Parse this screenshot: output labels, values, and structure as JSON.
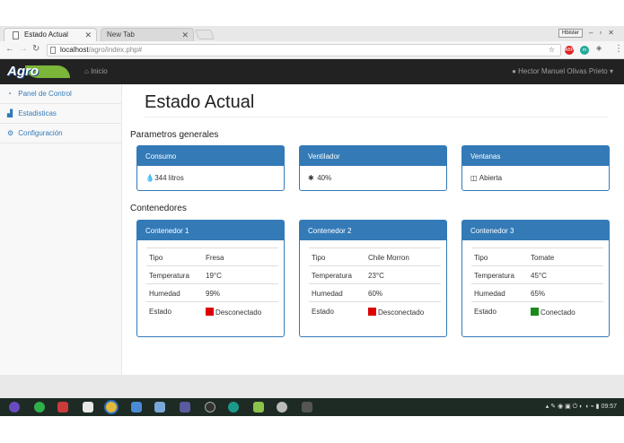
{
  "browser": {
    "tabs": [
      {
        "label": "Estado Actual",
        "active": true
      },
      {
        "label": "New Tab",
        "active": false
      }
    ],
    "profile_chip": "Hbister",
    "url_host": "localhost",
    "url_path": "/agro/index.php#",
    "ext_badges": [
      "ABP",
      "m"
    ]
  },
  "navbar": {
    "brand": "Agro",
    "home_label": "Inicio",
    "user_name": "Hector Manuel Olivas Prieto"
  },
  "sidebar": {
    "items": [
      {
        "label": "Panel de Control",
        "icon": "dashboard-icon"
      },
      {
        "label": "Estadisticas",
        "icon": "area-chart-icon"
      },
      {
        "label": "Configuración",
        "icon": "cogs-icon"
      }
    ]
  },
  "main": {
    "page_title": "Estado Actual",
    "general_heading": "Parametros generales",
    "general_panels": [
      {
        "title": "Consumo",
        "value": "344 litros",
        "icon": "tint-icon"
      },
      {
        "title": "Ventilador",
        "value": "40%",
        "icon": "snowflake-icon"
      },
      {
        "title": "Ventanas",
        "value": "Abierta",
        "icon": "window-icon"
      }
    ],
    "containers_heading": "Contenedores",
    "containers": [
      {
        "title": "Contenedor 1",
        "tipo_label": "Tipo",
        "tipo": "Fresa",
        "temp_label": "Temperatura",
        "temp": "19°C",
        "hum_label": "Humedad",
        "hum": "99%",
        "estado_label": "Estado",
        "estado": "Desconectado",
        "estado_color": "#dd0000"
      },
      {
        "title": "Contenedor 2",
        "tipo_label": "Tipo",
        "tipo": "Chile Morron",
        "temp_label": "Temperatura",
        "temp": "23°C",
        "hum_label": "Humedad",
        "hum": "60%",
        "estado_label": "Estado",
        "estado": "Desconectado",
        "estado_color": "#dd0000"
      },
      {
        "title": "Contenedor 3",
        "tipo_label": "Tipo",
        "tipo": "Tomate",
        "temp_label": "Temperatura",
        "temp": "45°C",
        "hum_label": "Humedad",
        "hum": "65%",
        "estado_label": "Estado",
        "estado": "Conectado",
        "estado_color": "#1a8a1a"
      }
    ]
  },
  "taskbar": {
    "clock": "09:57"
  },
  "colors": {
    "primary": "#337ab7",
    "navbar": "#222222",
    "disconnected": "#dd0000",
    "connected": "#1a8a1a"
  }
}
